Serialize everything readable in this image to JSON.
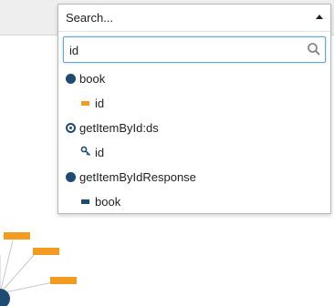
{
  "header": {
    "placeholder": "Search..."
  },
  "search": {
    "value": "id"
  },
  "results": [
    {
      "type": "group",
      "icon": "filled-circle-icon",
      "label": "book"
    },
    {
      "type": "child",
      "icon": "orange-bar-icon",
      "label": "id"
    },
    {
      "type": "group",
      "icon": "target-circle-icon",
      "label": "getItemById:ds"
    },
    {
      "type": "child",
      "icon": "key-icon",
      "label": "id"
    },
    {
      "type": "group",
      "icon": "filled-circle-icon",
      "label": "getItemByIdResponse"
    },
    {
      "type": "child",
      "icon": "navy-bar-icon",
      "label": "book"
    }
  ],
  "colors": {
    "accent": "#1e4b74",
    "field": "#f39a21",
    "focus": "#6aa3d6"
  }
}
